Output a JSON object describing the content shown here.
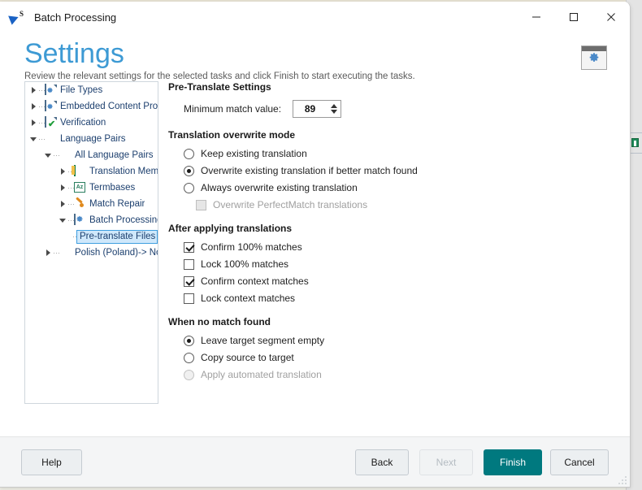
{
  "window": {
    "title": "Batch Processing",
    "app_icon": "trados-studio-icon",
    "controls": {
      "minimize": "minimize-icon",
      "maximize": "maximize-icon",
      "close": "close-icon"
    }
  },
  "header": {
    "title": "Settings",
    "subtitle": "Review the relevant settings for the selected tasks and click Finish to start executing the tasks.",
    "icon": "batch-processing-settings-icon",
    "title_color": "#3d9ad4"
  },
  "tree": {
    "items": [
      {
        "label": "File Types",
        "indent": 0,
        "twist": "collapsed",
        "icon": "file-types-icon",
        "selected": false
      },
      {
        "label": "Embedded Content Proc",
        "indent": 0,
        "twist": "collapsed",
        "icon": "embedded-content-icon",
        "selected": false
      },
      {
        "label": "Verification",
        "indent": 0,
        "twist": "collapsed",
        "icon": "verification-icon",
        "selected": false
      },
      {
        "label": "Language Pairs",
        "indent": 0,
        "twist": "expanded",
        "icon": "language-pairs-icon",
        "selected": false
      },
      {
        "label": "All Language Pairs",
        "indent": 1,
        "twist": "expanded",
        "icon": "all-language-pairs-icon",
        "selected": false
      },
      {
        "label": "Translation Memo",
        "indent": 2,
        "twist": "collapsed",
        "icon": "translation-memory-icon",
        "selected": false
      },
      {
        "label": "Termbases",
        "indent": 2,
        "twist": "collapsed",
        "icon": "termbases-icon",
        "selected": false
      },
      {
        "label": "Match Repair",
        "indent": 2,
        "twist": "collapsed",
        "icon": "match-repair-icon",
        "selected": false
      },
      {
        "label": "Batch Processing",
        "indent": 2,
        "twist": "expanded",
        "icon": "batch-processing-icon",
        "selected": false
      },
      {
        "label": "Pre-translate Files",
        "indent": 3,
        "twist": "none",
        "icon": "none",
        "selected": true
      },
      {
        "label": "Polish (Poland)-> Nor",
        "indent": 1,
        "twist": "collapsed",
        "icon": "language-pair-icon",
        "selected": false
      }
    ],
    "selection_bg": "#cfe8fb",
    "selection_border": "#3f9fe0"
  },
  "settings": {
    "pretranslate": {
      "group_title": "Pre-Translate Settings",
      "min_match_label": "Minimum match value:",
      "min_match_value": "89"
    },
    "overwrite_mode": {
      "group_title": "Translation overwrite mode",
      "options": [
        {
          "label": "Keep existing translation",
          "checked": false,
          "disabled": false
        },
        {
          "label": "Overwrite existing translation if better match found",
          "checked": true,
          "disabled": false
        },
        {
          "label": "Always overwrite existing translation",
          "checked": false,
          "disabled": false
        }
      ],
      "sub_checkbox": {
        "label": "Overwrite PerfectMatch translations",
        "checked": false,
        "disabled": true
      }
    },
    "after_applying": {
      "group_title": "After applying translations",
      "options": [
        {
          "label": "Confirm 100% matches",
          "checked": true,
          "disabled": false
        },
        {
          "label": "Lock 100% matches",
          "checked": false,
          "disabled": false
        },
        {
          "label": "Confirm context matches",
          "checked": true,
          "disabled": false
        },
        {
          "label": "Lock context matches",
          "checked": false,
          "disabled": false
        }
      ]
    },
    "no_match": {
      "group_title": "When no match found",
      "options": [
        {
          "label": "Leave target segment empty",
          "checked": true,
          "disabled": false
        },
        {
          "label": "Copy source to target",
          "checked": false,
          "disabled": false
        },
        {
          "label": "Apply automated translation",
          "checked": false,
          "disabled": true
        }
      ]
    }
  },
  "footer": {
    "help": {
      "label": "Help",
      "disabled": false,
      "primary": false
    },
    "back": {
      "label": "Back",
      "disabled": false,
      "primary": false
    },
    "next": {
      "label": "Next",
      "disabled": true,
      "primary": false
    },
    "finish": {
      "label": "Finish",
      "disabled": false,
      "primary": true
    },
    "cancel": {
      "label": "Cancel",
      "disabled": false,
      "primary": false
    },
    "primary_color": "#00797f"
  }
}
